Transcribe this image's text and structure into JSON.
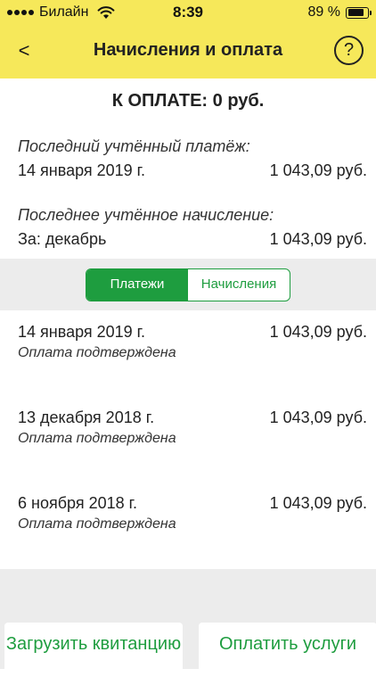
{
  "status_bar": {
    "carrier": "Билайн",
    "time": "8:39",
    "battery_percent": "89 %",
    "battery_level": 0.89
  },
  "nav": {
    "back_label": "<",
    "title": "Начисления и оплата",
    "help_label": "?"
  },
  "summary": {
    "to_pay": "К ОПЛАТЕ: 0 руб.",
    "last_payment_label": "Последний учтённый платёж:",
    "last_payment_date": "14 января 2019 г.",
    "last_payment_amount": "1 043,09 руб.",
    "last_charge_label": "Последнее учтённое начисление:",
    "last_charge_period": "За: декабрь",
    "last_charge_amount": "1 043,09 руб."
  },
  "tabs": [
    {
      "label": "Платежи",
      "active": true
    },
    {
      "label": "Начисления",
      "active": false
    }
  ],
  "payments": [
    {
      "date": "14 января 2019 г.",
      "amount": "1 043,09 руб.",
      "status": "Оплата подтверждена"
    },
    {
      "date": "13 декабря 2018 г.",
      "amount": "1 043,09 руб.",
      "status": "Оплата подтверждена"
    },
    {
      "date": "6 ноября 2018 г.",
      "amount": "1 043,09 руб.",
      "status": "Оплата подтверждена"
    }
  ],
  "buttons": {
    "upload_receipt": "Загрузить квитанцию",
    "pay_services": "Оплатить услуги"
  },
  "colors": {
    "header_bg": "#f6e85a",
    "accent_green": "#1e9d3f",
    "section_gray": "#ececec"
  },
  "icons": {
    "signal": "signal-dots-icon",
    "wifi": "wifi-icon",
    "battery": "battery-icon",
    "back": "chevron-left-icon",
    "help": "question-circle-icon"
  }
}
